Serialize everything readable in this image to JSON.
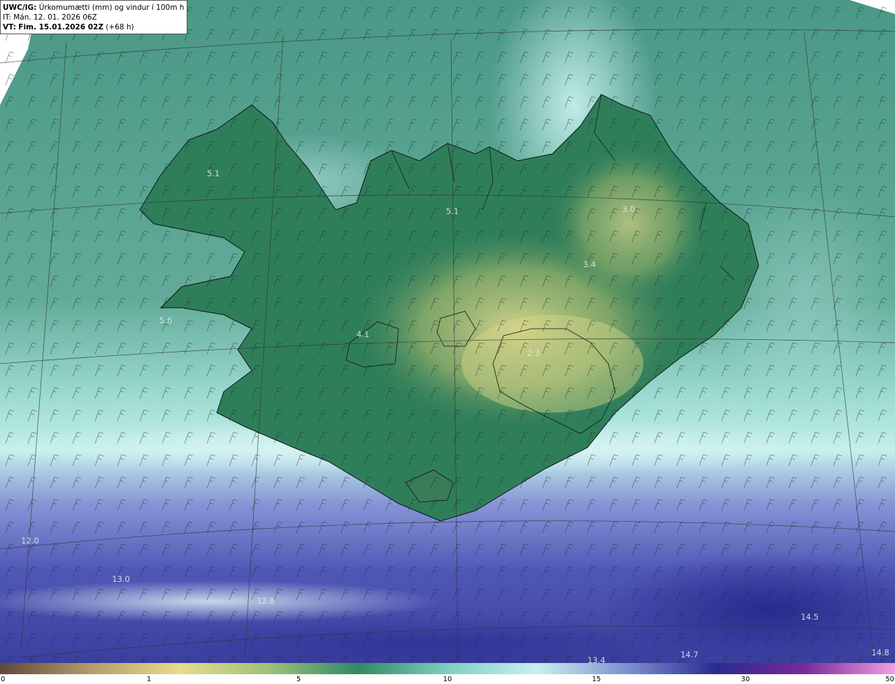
{
  "header": {
    "model": "UWC/IG:",
    "field": "Úrkomumætti (mm) og vindur í 100m hæð",
    "init_time": "IT: Mán. 12. 01. 2026 06Z",
    "valid_label": "VT:",
    "valid_time": "Fim. 15.01.2026 02Z",
    "lead_time": "(+68 h)"
  },
  "value_labels": [
    "5.1",
    "5.1",
    "3.0",
    "3.4",
    "5.6",
    "4.1",
    "2.3",
    "12.0",
    "13.0",
    "12.8",
    "14.5",
    "14.7",
    "13.4",
    "14.8"
  ],
  "colorbar": {
    "ticks": [
      "0",
      "1",
      "5",
      "10",
      "15",
      "30",
      "50"
    ],
    "colors": [
      "#5e4a3a",
      "#b49a6a",
      "#e6dc8c",
      "#9fc07a",
      "#2f8a63",
      "#7fcfc0",
      "#c8f0ee",
      "#8090d0",
      "#2a2a90",
      "#7a2a9a",
      "#f0a0e0"
    ]
  },
  "colors": {
    "sea_green": "#4f9a86",
    "land_green": "#2f7a58",
    "land_yellow": "#c7c780",
    "cyan_band": "#aee6e2",
    "south_blue": "#4a52b0"
  }
}
